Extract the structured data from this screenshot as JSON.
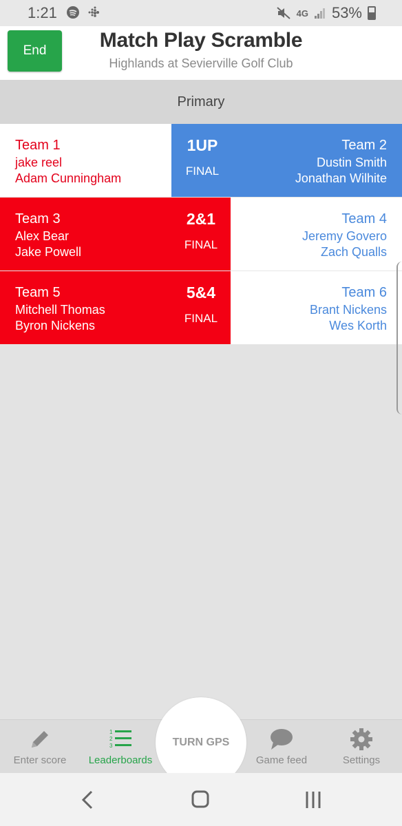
{
  "status_bar": {
    "time": "1:21",
    "network": "4G",
    "battery": "53%"
  },
  "header": {
    "end_label": "End",
    "title": "Match Play Scramble",
    "subtitle": "Highlands at Sevierville Golf Club"
  },
  "section_label": "Primary",
  "matches": [
    {
      "left_team": "Team 1",
      "left_players": [
        "jake reel",
        "Adam Cunningham"
      ],
      "score": "1UP",
      "status": "FINAL",
      "right_team": "Team 2",
      "right_players": [
        "Dustin Smith",
        "Jonathan Wilhite"
      ],
      "winner": "right",
      "colors": {
        "left_bg": "#ffffff",
        "right_bg": "#4a89dc"
      }
    },
    {
      "left_team": "Team 3",
      "left_players": [
        "Alex Bear",
        "Jake Powell"
      ],
      "score": "2&1",
      "status": "FINAL",
      "right_team": "Team 4",
      "right_players": [
        "Jeremy Govero",
        "Zach Qualls"
      ],
      "winner": "left",
      "colors": {
        "left_bg": "#f30014",
        "right_bg": "#ffffff"
      }
    },
    {
      "left_team": "Team 5",
      "left_players": [
        "Mitchell Thomas",
        "Byron Nickens"
      ],
      "score": "5&4",
      "status": "FINAL",
      "right_team": "Team 6",
      "right_players": [
        "Brant Nickens",
        "Wes Korth"
      ],
      "winner": "left",
      "colors": {
        "left_bg": "#f30014",
        "right_bg": "#ffffff"
      }
    }
  ],
  "bottom_nav": {
    "enter_score": "Enter score",
    "leaderboards": "Leaderboards",
    "gps": "TURN GPS",
    "game_feed": "Game feed",
    "settings": "Settings",
    "active": "leaderboards"
  },
  "icons": {
    "enter_score": "pencil-icon",
    "leaderboards": "numbered-list-icon",
    "game_feed": "chat-bubble-icon",
    "settings": "gear-icon"
  },
  "colors": {
    "accent_green": "#27a44a",
    "team_red": "#f30014",
    "team_blue": "#4a89dc"
  }
}
